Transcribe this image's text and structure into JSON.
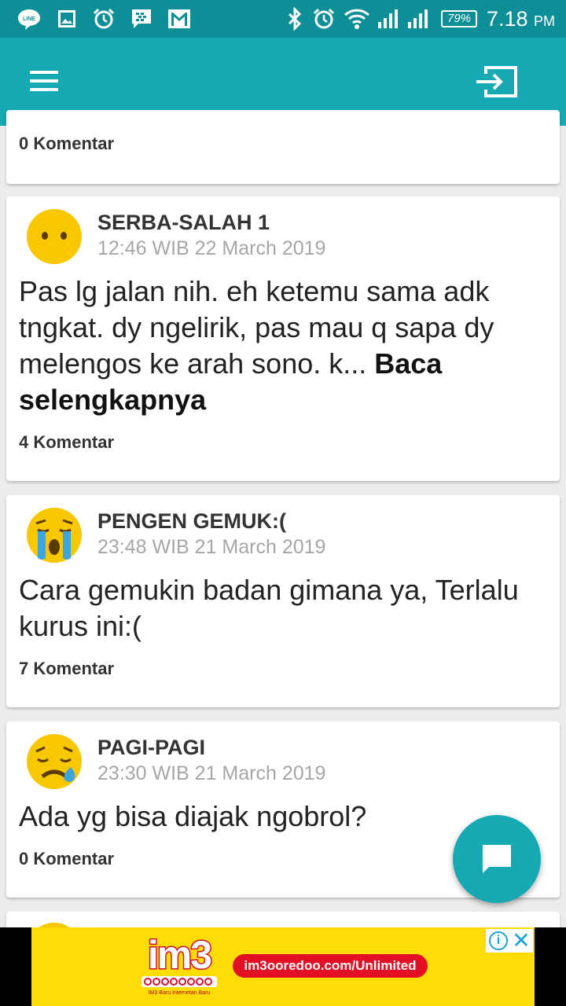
{
  "status_bar": {
    "battery": "79%",
    "time": "7.18",
    "ampm": "PM",
    "icons": [
      "line-icon",
      "image-icon",
      "alarm-icon",
      "bbm-icon",
      "gmail-icon",
      "bluetooth-icon",
      "alarm-icon",
      "wifi-icon",
      "signal-icon",
      "signal-icon",
      "battery-icon"
    ]
  },
  "app_bar": {
    "menu_icon": "hamburger-icon",
    "login_icon": "login-icon"
  },
  "posts": [
    {
      "comments": "0 Komentar"
    },
    {
      "emoji": "neutral-face-icon",
      "title": "SERBA-SALAH 1",
      "time": "12:46 WIB 22 March 2019",
      "body": "Pas lg jalan nih. eh ketemu sama adk tngkat. dy ngelirik, pas mau q sapa dy melengos ke arah sono. k...",
      "more": "Baca selengkapnya",
      "comments": "4 Komentar"
    },
    {
      "emoji": "crying-face-icon",
      "title": "PENGEN GEMUK:(",
      "time": "23:48 WIB 21 March 2019",
      "body": "Cara gemukin badan gimana ya, Terlalu kurus ini:(",
      "comments": "7 Komentar"
    },
    {
      "emoji": "sad-tear-face-icon",
      "title": "PAGI-PAGI",
      "time": "23:30 WIB 21 March 2019",
      "body": "Ada yg bisa diajak ngobrol?",
      "comments": "0 Komentar"
    }
  ],
  "fab": {
    "icon": "chat-icon"
  },
  "ad": {
    "logo": "im3",
    "tagline": "IM3 Baru Internetan Baru",
    "url": "im3ooredoo.com/Unlimited",
    "choices_icon": "adchoices-icon",
    "close_icon": "close-icon"
  },
  "colors": {
    "status_bar": "#0e8f97",
    "app_bar": "#14a9b3",
    "fab": "#14a9b3",
    "ad_background": "#fedd06"
  }
}
